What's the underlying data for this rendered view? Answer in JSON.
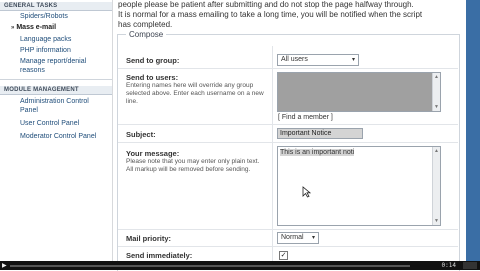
{
  "sidebar": {
    "section_general": "GENERAL TASKS",
    "item_spiders": "Spiders/Robots",
    "item_mass_email": "Mass e-mail",
    "item_language": "Language packs",
    "item_php": "PHP information",
    "item_manage_reports": "Manage report/denial reasons",
    "section_module": "MODULE MANAGEMENT",
    "item_acp": "Administration Control Panel",
    "item_ucp": "User Control Panel",
    "item_mcp": "Moderator Control Panel"
  },
  "intro": {
    "line1": "people please be patient after submitting and do not stop the page halfway through.",
    "line2": "It is normal for a mass emailing to take a long time, you will be notified when the script",
    "line3": "has completed."
  },
  "compose": {
    "legend": "Compose",
    "group_label": "Send to group:",
    "group_value": "All users",
    "users_label": "Send to users:",
    "users_help": "Entering names here will override any group selected above. Enter each username on a new line.",
    "find_member": "[ Find a member ]",
    "subject_label": "Subject:",
    "subject_value": "Important Notice",
    "message_label": "Your message:",
    "message_help": "Please note that you may enter only plain text. All markup will be removed before sending.",
    "message_value": "This is an important noti",
    "priority_label": "Mail priority:",
    "priority_value": "Normal",
    "immediate_label": "Send immediately:",
    "immediate_checked": "✓"
  },
  "video": {
    "time": "0:14"
  },
  "icons": {
    "caret": "▾",
    "arrow": "»",
    "play": "▶",
    "up": "▲",
    "down": "▼"
  }
}
